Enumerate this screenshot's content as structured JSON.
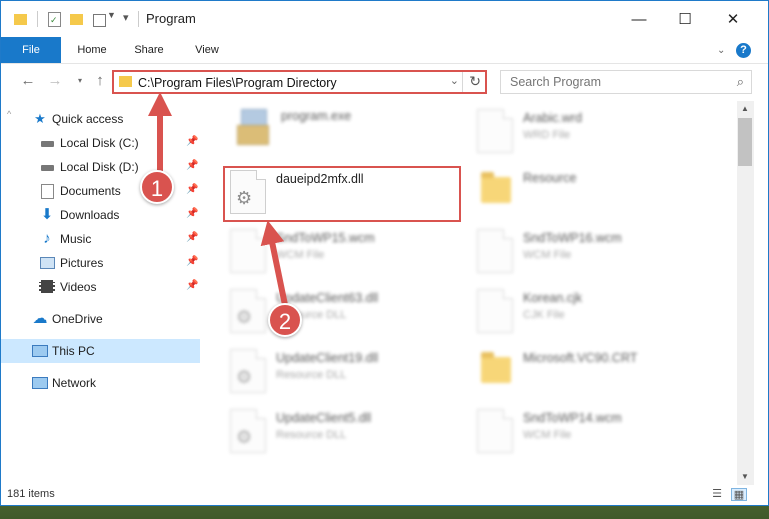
{
  "window": {
    "title": "Program",
    "controls": {
      "minimize": "—",
      "maximize": "☐",
      "close": "✕"
    }
  },
  "ribbon": {
    "tabs": [
      "File",
      "Home",
      "Share",
      "View"
    ],
    "help_icon": "?"
  },
  "navigation": {
    "address": "C:\\Program Files\\Program Directory",
    "search_placeholder": "Search Program"
  },
  "sidebar": {
    "items": [
      {
        "label": "Quick access",
        "icon": "star-icon"
      },
      {
        "label": "Local Disk (C:)",
        "icon": "drive-icon",
        "pinned": true
      },
      {
        "label": "Local Disk (D:)",
        "icon": "drive-icon",
        "pinned": true
      },
      {
        "label": "Documents",
        "icon": "documents-icon",
        "pinned": true
      },
      {
        "label": "Downloads",
        "icon": "download-icon",
        "pinned": true
      },
      {
        "label": "Music",
        "icon": "music-icon",
        "pinned": true
      },
      {
        "label": "Pictures",
        "icon": "pictures-icon",
        "pinned": true
      },
      {
        "label": "Videos",
        "icon": "videos-icon",
        "pinned": true
      },
      {
        "label": "OneDrive",
        "icon": "cloud-icon"
      },
      {
        "label": "This PC",
        "icon": "computer-icon",
        "selected": true
      },
      {
        "label": "Network",
        "icon": "network-icon"
      }
    ]
  },
  "files": {
    "left": [
      {
        "name": "program.exe",
        "type": ""
      },
      {
        "name": "daueipd2mfx.dll",
        "type": ""
      },
      {
        "name": "SndToWP15.wcm",
        "type": "WCM File"
      },
      {
        "name": "UpdateClient63.dll",
        "type": "Resource DLL"
      },
      {
        "name": "UpdateClient19.dll",
        "type": "Resource DLL"
      },
      {
        "name": "UpdateClient5.dll",
        "type": "Resource DLL"
      }
    ],
    "right": [
      {
        "name": "Arabic.wrd",
        "type": "WRD File"
      },
      {
        "name": "Resource",
        "type": ""
      },
      {
        "name": "SndToWP16.wcm",
        "type": "WCM File"
      },
      {
        "name": "Korean.cjk",
        "type": "CJK File"
      },
      {
        "name": "Microsoft.VC90.CRT",
        "type": ""
      },
      {
        "name": "SndToWP14.wcm",
        "type": "WCM File"
      }
    ]
  },
  "status": {
    "item_count": "181 items"
  },
  "annotations": {
    "step1": "1",
    "step2": "2",
    "color": "#d9534f"
  }
}
